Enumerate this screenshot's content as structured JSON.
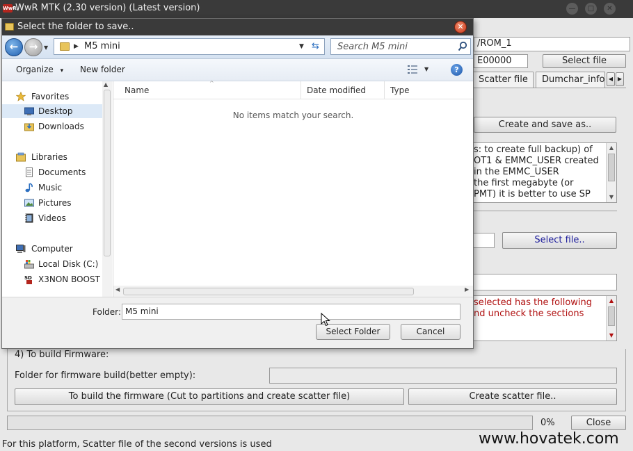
{
  "app": {
    "title": "WwR MTK (2.30 version) (Latest version)",
    "logo_text": "WwR",
    "path_value": "/ROM_1",
    "address_value": "E00000",
    "select_file_label": "Select file",
    "tabs": [
      "Scatter file",
      "Dumchar_info"
    ],
    "create_save_label": "Create and save as..",
    "info_lines": [
      "s: to create full backup) of",
      "OT1 & EMMC_USER created",
      " in the EMMC_USER",
      " the first megabyte (or",
      "PMT) it is better to use SP",
      " "
    ],
    "select_file2_label": "Select file..",
    "warning_lines": [
      "selected has the following",
      "nd uncheck the sections"
    ],
    "section4_label": "4) To build Firmware:",
    "firmware_folder_label": "Folder for firmware build(better empty):",
    "build_firmware_label": "To build the firmware (Cut to partitions and create scatter file)",
    "create_scatter_label": "Create scatter file..",
    "progress_text": "0%",
    "progress_value": 0,
    "close_label": "Close",
    "status_text": "For this platform, Scatter file of the second versions is used"
  },
  "dialog": {
    "title": "Select the folder to save..",
    "address_folder": "M5 mini",
    "search_placeholder": "Search M5 mini",
    "toolbar": {
      "organize": "Organize",
      "organize_caret": "▾",
      "new_folder": "New folder"
    },
    "nav": {
      "favorites": "Favorites",
      "desktop": "Desktop",
      "downloads": "Downloads",
      "libraries": "Libraries",
      "documents": "Documents",
      "music": "Music",
      "pictures": "Pictures",
      "videos": "Videos",
      "computer": "Computer",
      "local_disk": "Local Disk (C:)",
      "x3non": "X3NON BOOST"
    },
    "columns": {
      "name": "Name",
      "date_modified": "Date modified",
      "type": "Type"
    },
    "empty_message": "No items match your search.",
    "folder_label": "Folder:",
    "folder_value": "M5 mini",
    "select_folder_label": "Select Folder",
    "cancel_label": "Cancel"
  },
  "watermark": "www.hovatek.com"
}
